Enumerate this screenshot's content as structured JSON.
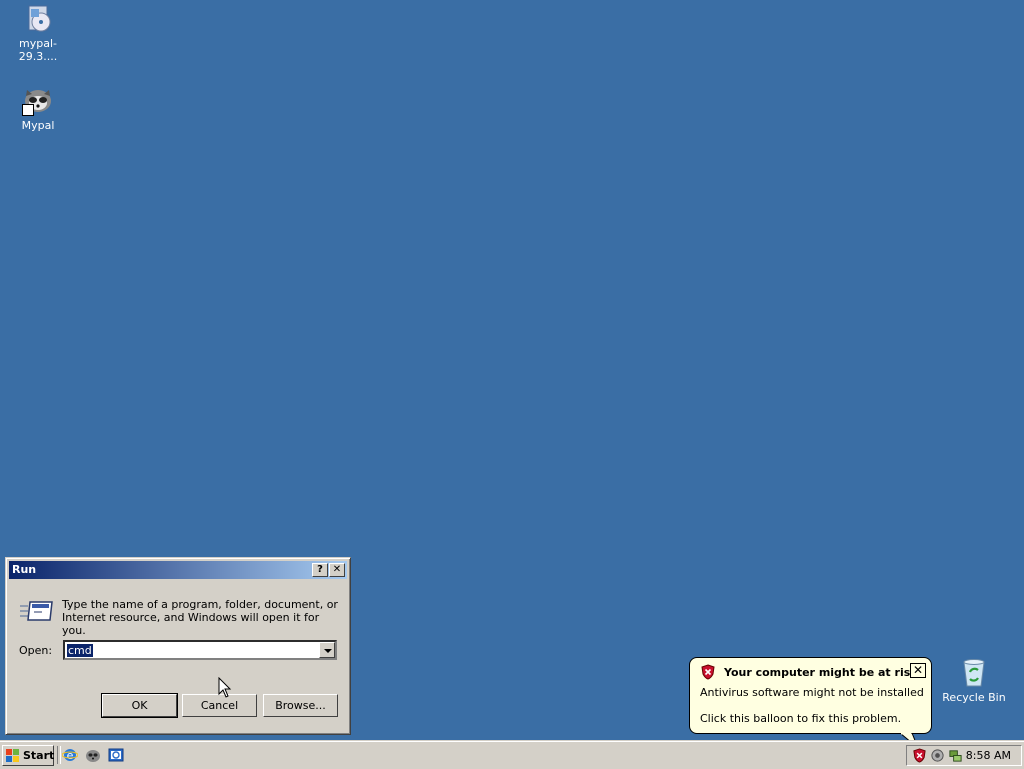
{
  "desktop": {
    "icons": [
      {
        "label": "mypal-29.3...."
      },
      {
        "label": "Mypal"
      },
      {
        "label": "Recycle Bin"
      }
    ],
    "background_color": "#3a6ea5"
  },
  "run_dialog": {
    "title": "Run",
    "help_button": "?",
    "close_button": "✕",
    "description": "Type the name of a program, folder, document, or Internet resource, and Windows will open it for you.",
    "open_label": "Open:",
    "open_value": "cmd",
    "ok_label": "OK",
    "cancel_label": "Cancel",
    "browse_label": "Browse..."
  },
  "balloon": {
    "title": "Your computer might be at risk",
    "line1": "Antivirus software might not be installed",
    "line2": "Click this balloon to fix this problem.",
    "close": "✕"
  },
  "taskbar": {
    "start_label": "Start",
    "quick_launch": [
      "ie-icon",
      "mypal-icon",
      "outlook-icon"
    ],
    "tray_icons": [
      "security-shield-icon",
      "volume-icon",
      "network-icon"
    ],
    "clock": "8:58 AM"
  }
}
